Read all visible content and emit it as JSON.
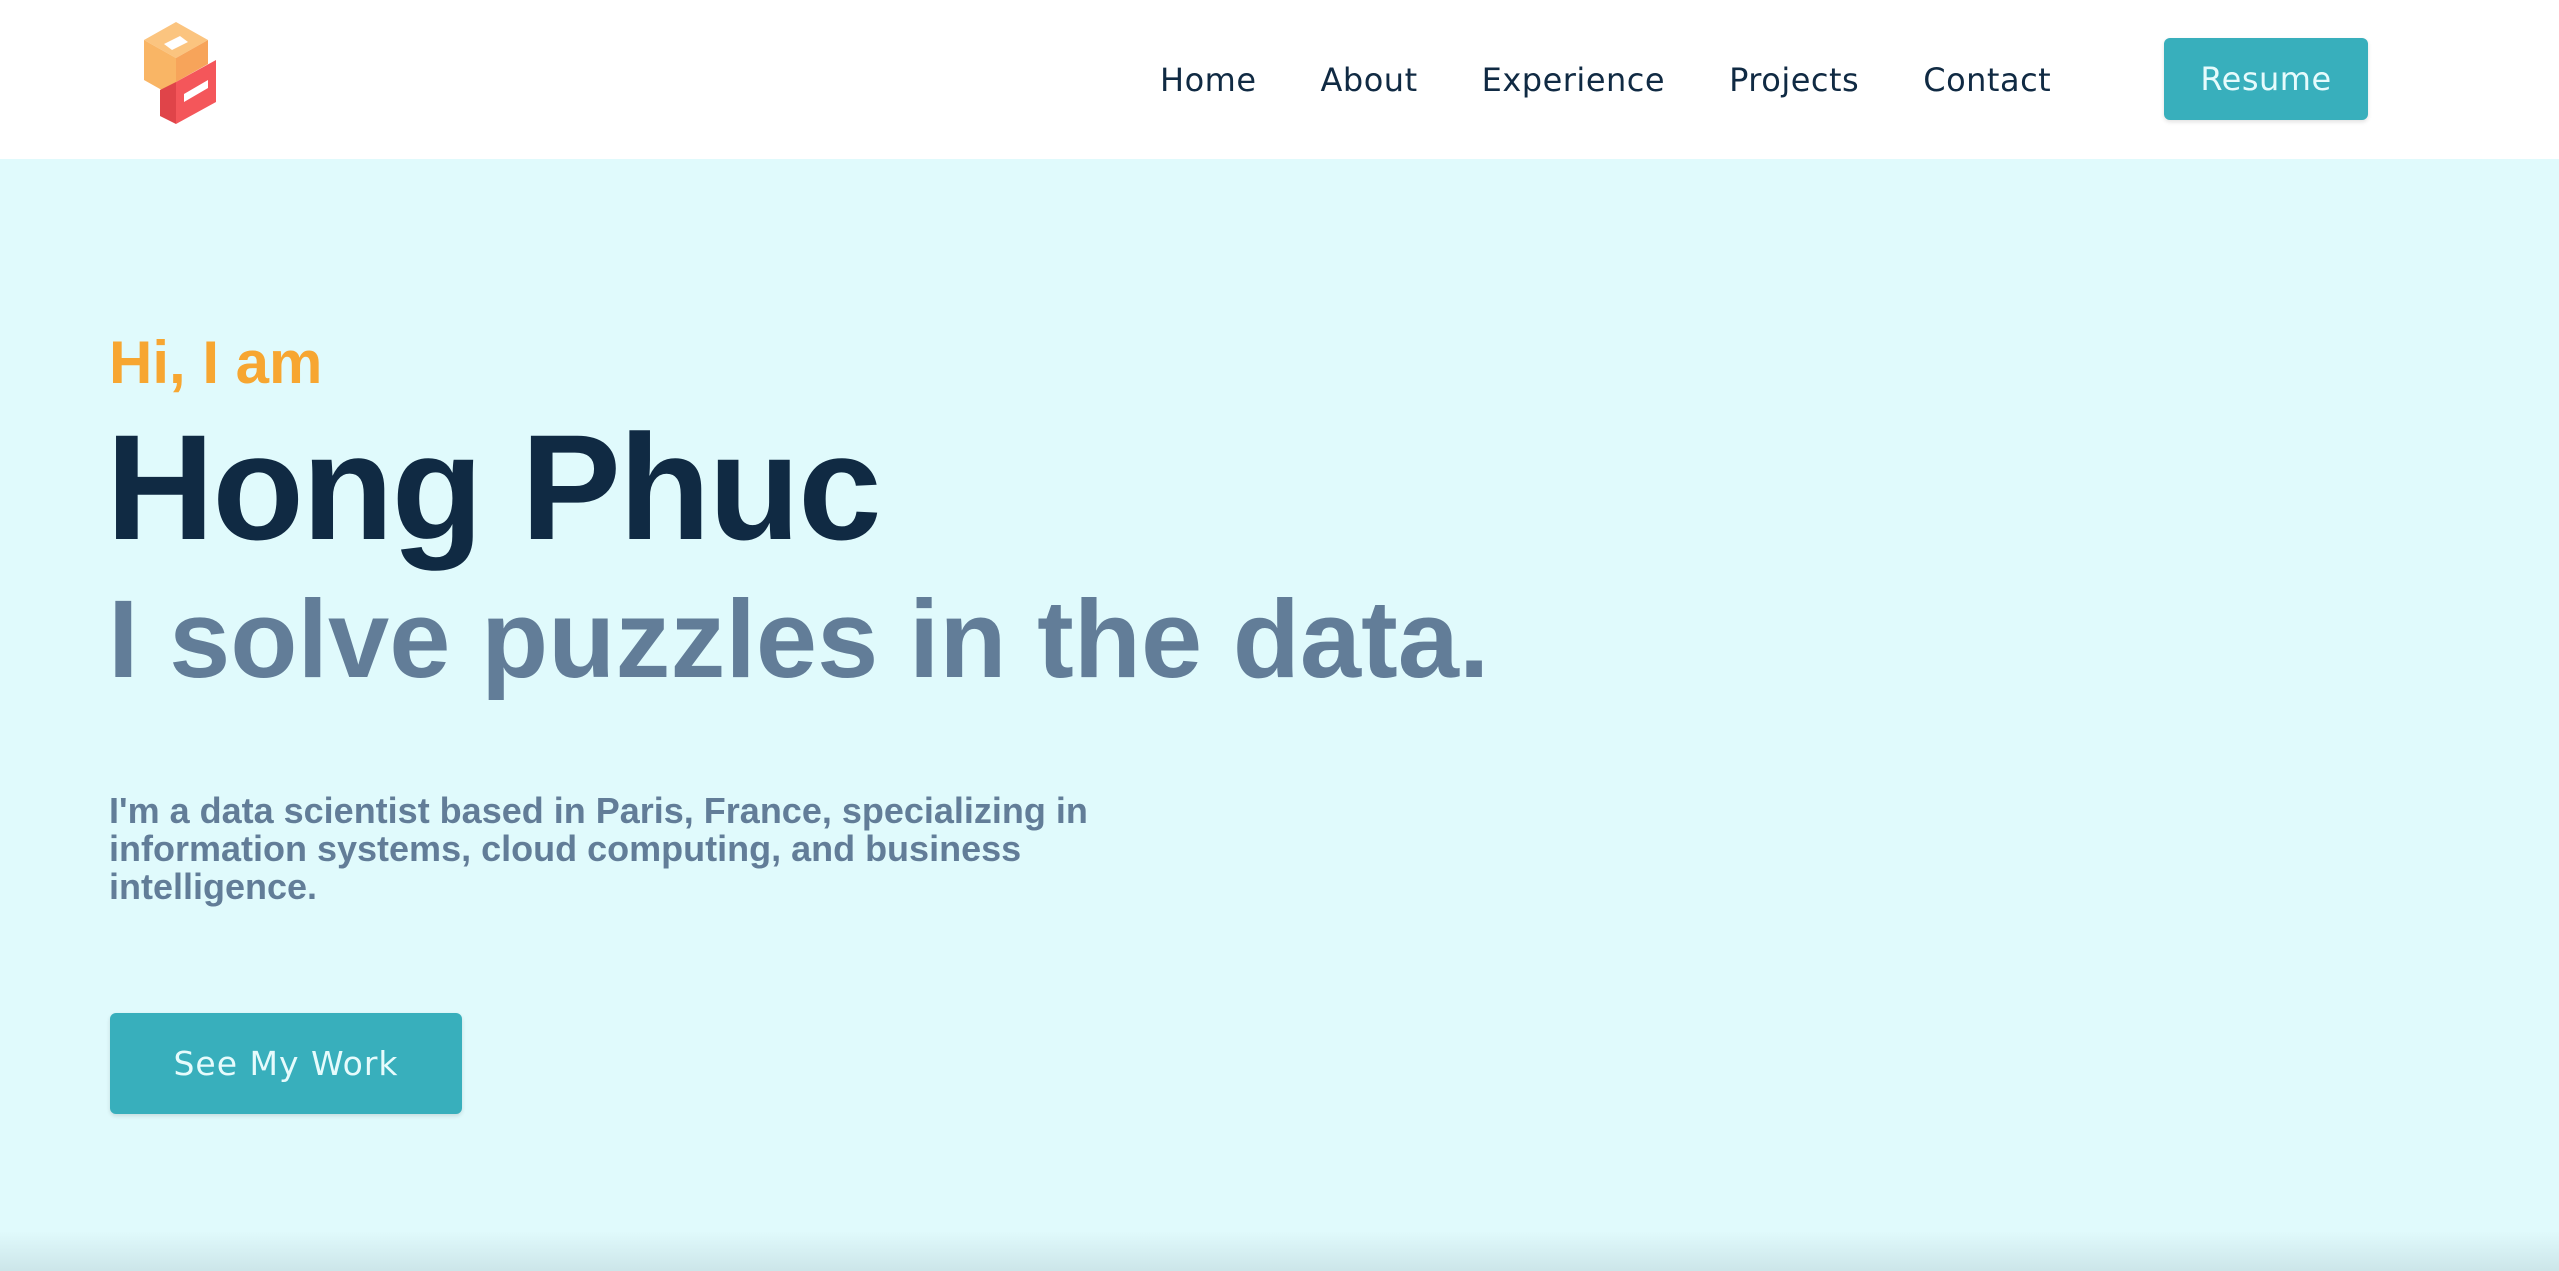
{
  "brand": {
    "logo": "pc-cube-logo"
  },
  "nav": {
    "items": [
      {
        "label": "Home"
      },
      {
        "label": "About"
      },
      {
        "label": "Experience"
      },
      {
        "label": "Projects"
      },
      {
        "label": "Contact"
      }
    ],
    "resume_label": "Resume"
  },
  "hero": {
    "greeting": "Hi, I am",
    "name": "Hong Phuc",
    "tagline": "I solve puzzles in the data.",
    "bio": "I'm a data scientist based in Paris, France, specializing in information systems, cloud computing, and business intelligence.",
    "cta_label": "See My Work"
  },
  "colors": {
    "accent": "#38afbc",
    "greeting": "#f7a631",
    "heading": "#102a43",
    "muted": "#627d98",
    "background": "#e0fafc",
    "logo_orange": "#f9b565",
    "logo_red": "#f4565a"
  }
}
